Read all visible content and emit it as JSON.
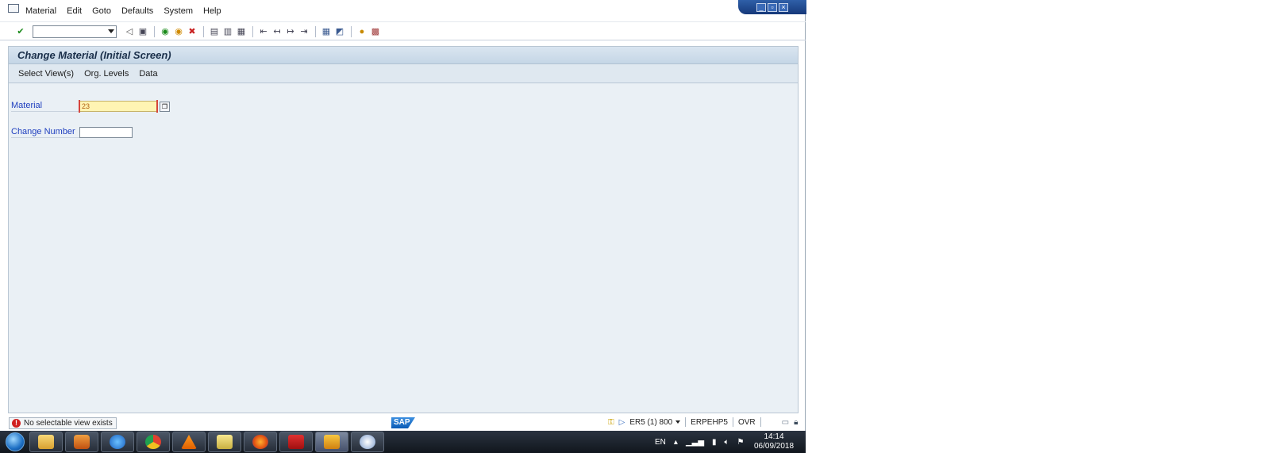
{
  "menu": {
    "items": [
      "Material",
      "Edit",
      "Goto",
      "Defaults",
      "System",
      "Help"
    ]
  },
  "toolbar": {
    "command_field_value": "",
    "icons": [
      "enter-icon",
      "back-icon",
      "save-icon",
      "back-green-icon",
      "exit-icon",
      "cancel-icon",
      "print-icon",
      "find-icon",
      "find-next-icon",
      "first-page-icon",
      "previous-page-icon",
      "next-page-icon",
      "last-page-icon",
      "create-session-icon",
      "shortcut-icon",
      "help-icon",
      "customize-layout-icon"
    ]
  },
  "screen": {
    "title": "Change Material (Initial Screen)",
    "app_toolbar": [
      "Select View(s)",
      "Org. Levels",
      "Data"
    ],
    "material_label": "Material",
    "material_value": "23",
    "change_number_label": "Change Number",
    "change_number_value": ""
  },
  "status": {
    "message": "No selectable view exists",
    "logo": "SAP",
    "system": "ER5 (1) 800",
    "server": "ERPEHP5",
    "mode": "OVR"
  },
  "taskbar": {
    "language": "EN",
    "time": "14:14",
    "date": "06/09/2018"
  },
  "colors": {
    "label_blue": "#1f3fbf",
    "required_field": "#fff4b3",
    "panel_bg": "#eaf0f5",
    "error_red": "#d02020"
  }
}
